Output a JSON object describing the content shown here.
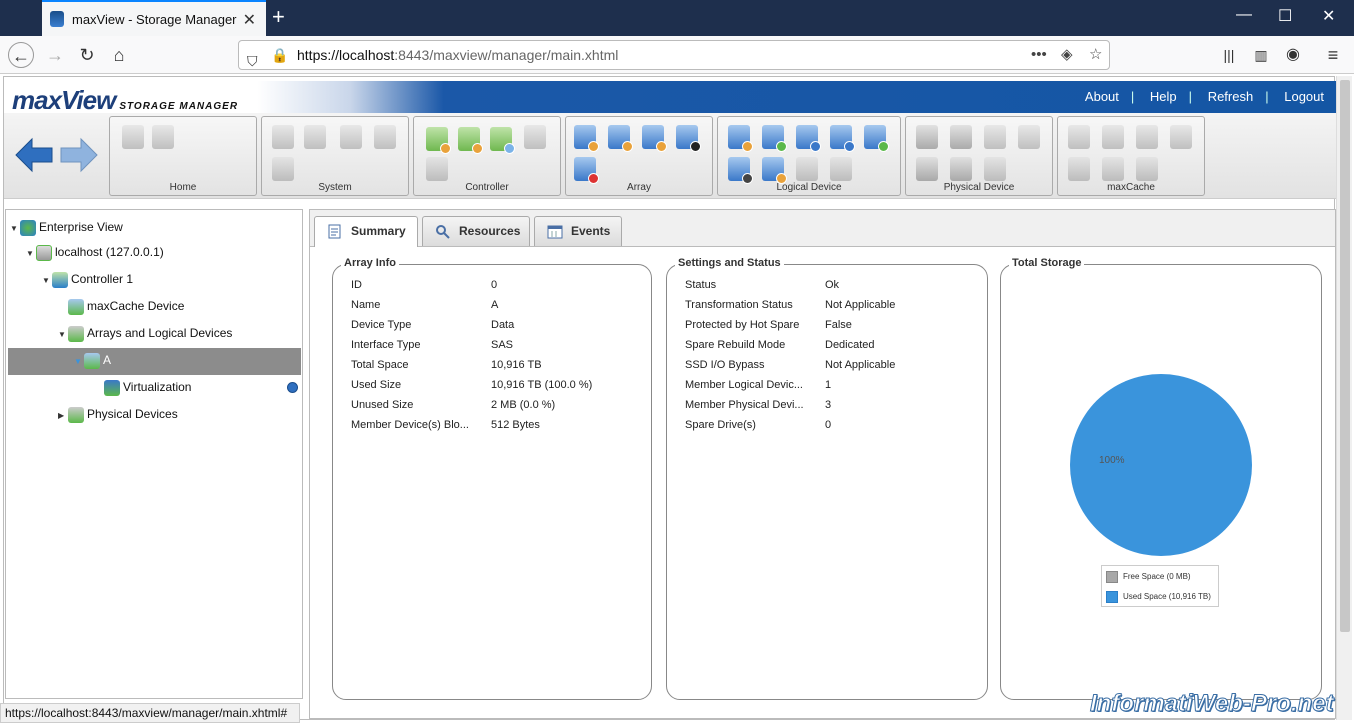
{
  "browser": {
    "tab_title": "maxView - Storage Manager",
    "url_host": "https://localhost",
    "url_rest": ":8443/maxview/manager/main.xhtml",
    "status_url": "https://localhost:8443/maxview/manager/main.xhtml#"
  },
  "app": {
    "logo_main": "maxView",
    "logo_sub": "STORAGE MANAGER",
    "links": [
      "About",
      "Help",
      "Refresh",
      "Logout"
    ]
  },
  "toolbar_groups": [
    "Home",
    "System",
    "Controller",
    "Array",
    "Logical Device",
    "Physical Device",
    "maxCache"
  ],
  "tree": {
    "enterprise": "Enterprise View",
    "host": "localhost (127.0.0.1)",
    "controller": "Controller 1",
    "maxcache": "maxCache Device",
    "arrays": "Arrays and Logical Devices",
    "array_a": "A",
    "virtualization": "Virtualization",
    "physical": "Physical Devices"
  },
  "tabs": [
    "Summary",
    "Resources",
    "Events"
  ],
  "array_info": {
    "title": "Array Info",
    "rows": [
      {
        "label": "ID",
        "value": "0"
      },
      {
        "label": "Name",
        "value": "A"
      },
      {
        "label": "Device Type",
        "value": "Data"
      },
      {
        "label": "Interface Type",
        "value": "SAS"
      },
      {
        "label": "Total Space",
        "value": "10,916 TB"
      },
      {
        "label": "Used Size",
        "value": "10,916 TB (100.0 %)"
      },
      {
        "label": "Unused Size",
        "value": "2 MB (0.0 %)"
      },
      {
        "label": "Member Device(s) Blo...",
        "value": "512 Bytes"
      }
    ]
  },
  "settings_status": {
    "title": "Settings and Status",
    "rows": [
      {
        "label": "Status",
        "value": "Ok"
      },
      {
        "label": "Transformation Status",
        "value": "Not Applicable"
      },
      {
        "label": "Protected by Hot Spare",
        "value": "False"
      },
      {
        "label": "Spare Rebuild Mode",
        "value": "Dedicated"
      },
      {
        "label": "SSD I/O Bypass",
        "value": "Not Applicable"
      },
      {
        "label": "Member Logical Devic...",
        "value": "1"
      },
      {
        "label": "Member Physical Devi...",
        "value": "3"
      },
      {
        "label": "Spare Drive(s)",
        "value": "0"
      }
    ]
  },
  "total_storage": {
    "title": "Total Storage",
    "pie_label": "100%",
    "legend": [
      {
        "label": "Free Space (0 MB)",
        "color": "#a8a8a8",
        "fraction": 0.0
      },
      {
        "label": "Used Space (10,916 TB)",
        "color": "#3a94dc",
        "fraction": 1.0
      }
    ]
  },
  "watermark": "InformatiWeb-Pro.net"
}
